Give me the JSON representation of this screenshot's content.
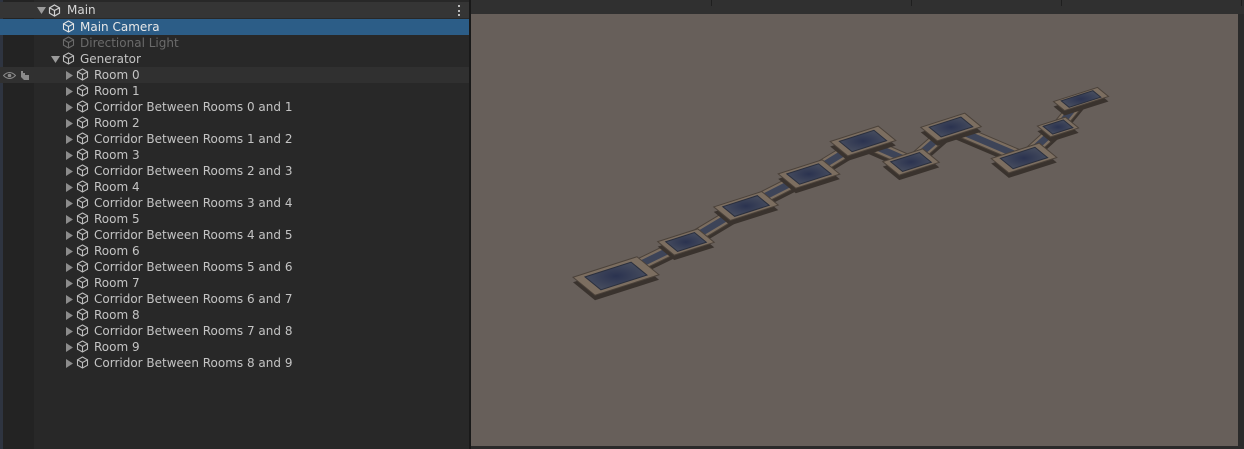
{
  "hierarchy": {
    "scene_name": "Main",
    "items": [
      {
        "label": "Main Camera",
        "state": "selected"
      },
      {
        "label": "Directional Light",
        "state": "disabled"
      },
      {
        "label": "Generator",
        "state": "expanded"
      },
      {
        "label": "Room 0",
        "state": "hover"
      },
      {
        "label": "Room 1"
      },
      {
        "label": "Corridor Between Rooms 0 and 1"
      },
      {
        "label": "Room 2"
      },
      {
        "label": "Corridor Between Rooms 1 and 2"
      },
      {
        "label": "Room 3"
      },
      {
        "label": "Corridor Between Rooms 2 and 3"
      },
      {
        "label": "Room 4"
      },
      {
        "label": "Corridor Between Rooms 3 and 4"
      },
      {
        "label": "Room 5"
      },
      {
        "label": "Corridor Between Rooms 4 and 5"
      },
      {
        "label": "Room 6"
      },
      {
        "label": "Corridor Between Rooms 5 and 6"
      },
      {
        "label": "Room 7"
      },
      {
        "label": "Corridor Between Rooms 6 and 7"
      },
      {
        "label": "Room 8"
      },
      {
        "label": "Corridor Between Rooms 7 and 8"
      },
      {
        "label": "Room 9"
      },
      {
        "label": "Corridor Between Rooms 8 and 9"
      }
    ]
  },
  "icons": {
    "scene": "unity-scene-icon",
    "gameobject": "cube-icon",
    "visibility": "eye-icon",
    "pickability": "hand-icon",
    "menu": "kebab-menu-icon",
    "foldout_open": "triangle-down-icon",
    "foldout_closed": "triangle-right-icon"
  },
  "colors": {
    "panel_bg": "#282828",
    "selection": "#2c5d87",
    "scene_bg": "#675f5a",
    "room_floor": "#3a4254",
    "room_wall": "#7c6e60"
  }
}
